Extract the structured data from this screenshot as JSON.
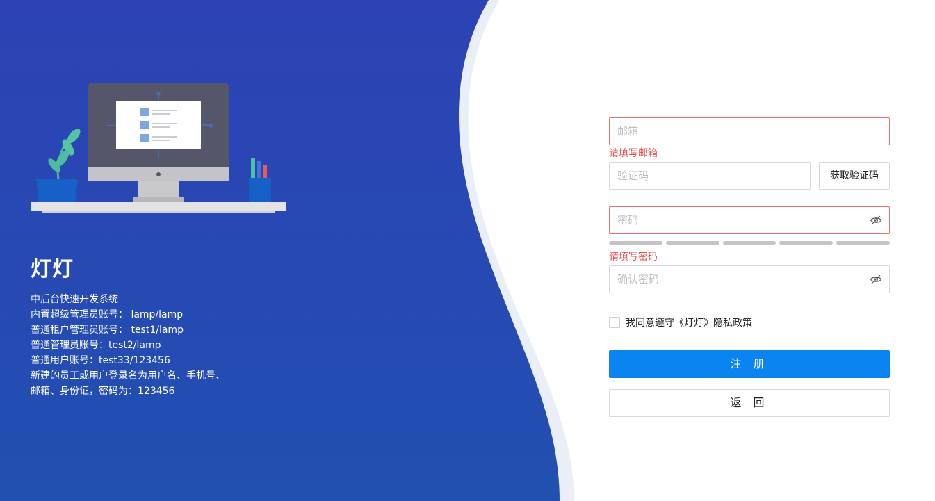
{
  "brand": {
    "title": "灯灯",
    "intro_lines": [
      "中后台快速开发系统",
      "内置超级管理员账号： lamp/lamp",
      "普通租户管理员账号： test1/lamp",
      "普通管理员账号：test2/lamp",
      "普通用户账号：test33/123456",
      "新建的员工或用户登录名为用户名、手机号、",
      "邮箱、身份证，密码为：123456"
    ]
  },
  "form": {
    "email": {
      "placeholder": "邮箱",
      "value": "",
      "error": "请填写邮箱"
    },
    "code": {
      "placeholder": "验证码",
      "value": "",
      "button_label": "获取验证码"
    },
    "password": {
      "placeholder": "密码",
      "value": "",
      "error": "请填写密码"
    },
    "confirm_password": {
      "placeholder": "确认密码",
      "value": ""
    },
    "agree_text": "我同意遵守《灯灯》隐私政策",
    "submit_label": "注 册",
    "back_label": "返 回"
  },
  "icons": {
    "password_toggle": "eye-off-icon",
    "confirm_toggle": "eye-off-icon"
  },
  "colors": {
    "brand_blue": "#2a47b8",
    "primary_button": "#0a84f0",
    "error": "#ed4e4e"
  }
}
